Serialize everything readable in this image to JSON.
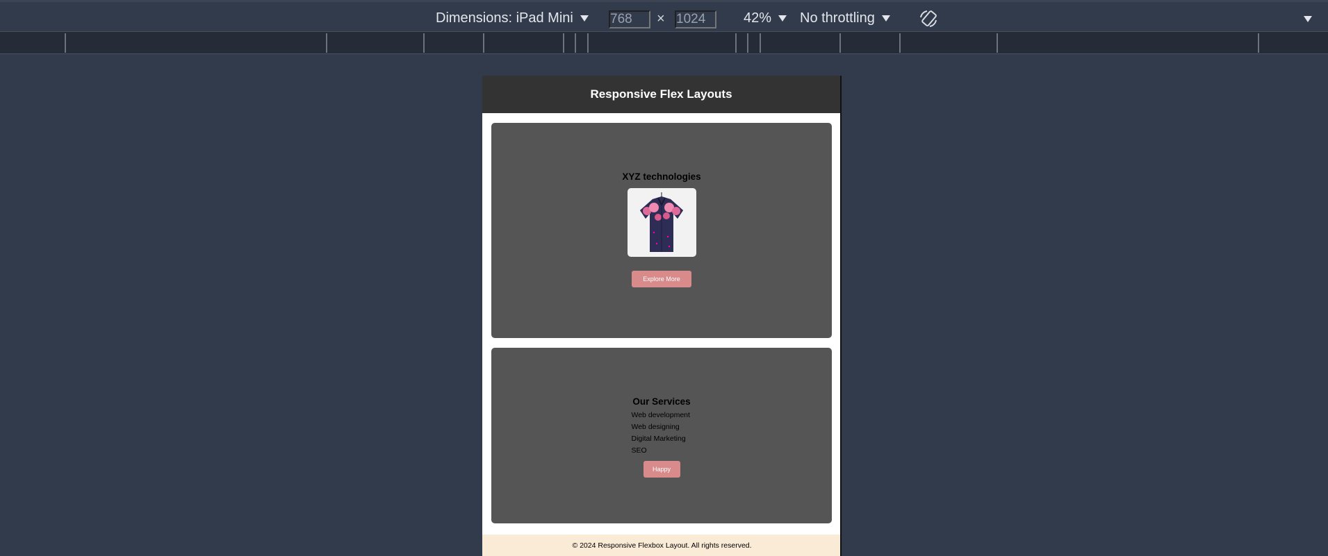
{
  "devtools": {
    "dimensions_label": "Dimensions: iPad Mini",
    "width_value": "768",
    "times_symbol": "×",
    "height_value": "1024",
    "zoom_label": "42%",
    "throttling_label": "No throttling"
  },
  "page": {
    "header_title": "Responsive Flex Layouts",
    "card1": {
      "title": "XYZ technologies",
      "button_label": "Explore More"
    },
    "card2": {
      "title": "Our Services",
      "services": [
        "Web development",
        "Web designing",
        "Digital Marketing",
        "SEO"
      ],
      "button_label": "Happy"
    },
    "footer_text": "© 2024 Responsive Flexbox Layout. All rights reserved."
  },
  "colors": {
    "devtools_bg": "#323b4b",
    "site_header_bg": "#333333",
    "card_bg": "#555555",
    "button_bg": "#d98a8a",
    "footer_bg": "#faebd7"
  }
}
